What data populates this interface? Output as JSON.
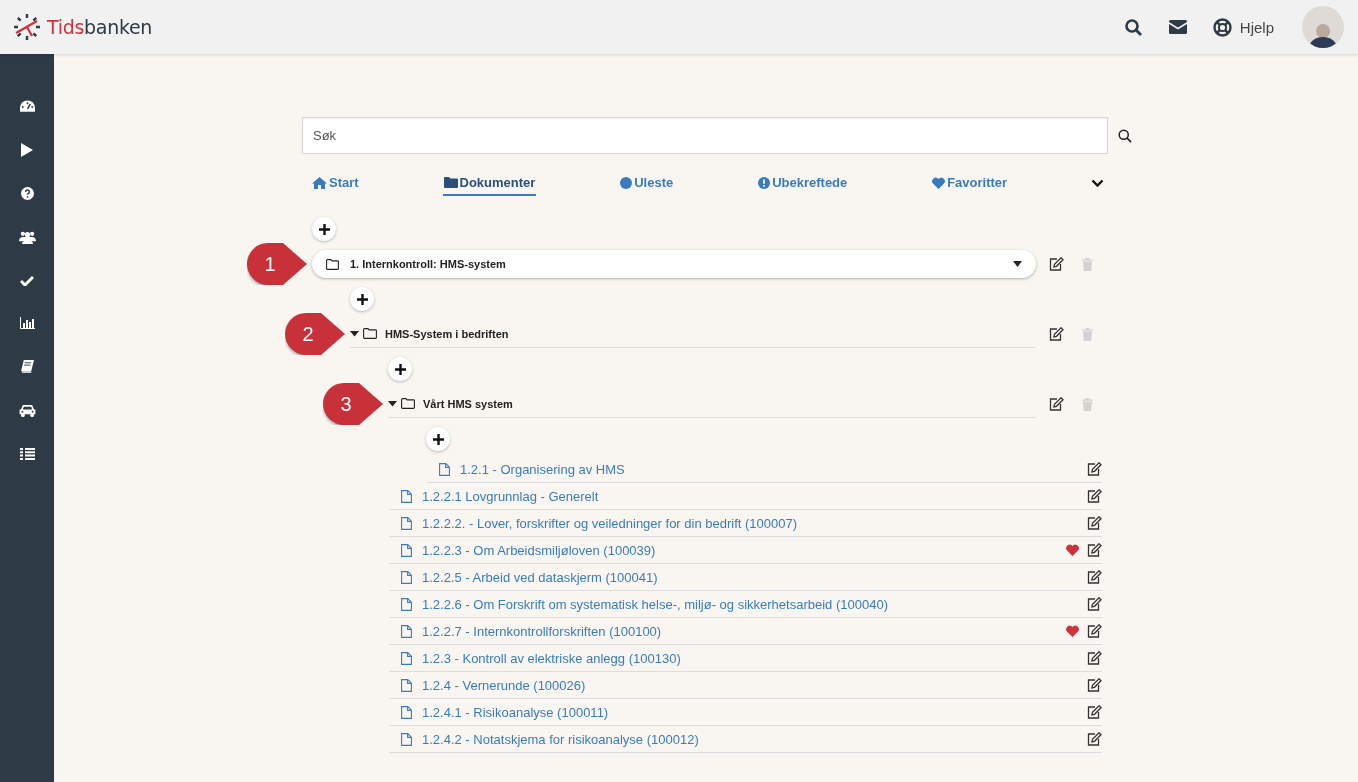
{
  "header": {
    "logo": {
      "accent": "Tids",
      "rest": "banken"
    },
    "help_label": "Hjelp"
  },
  "sidebar": {
    "groups": [
      [
        {
          "kind": "gauge"
        },
        {
          "kind": "play"
        }
      ],
      [
        {
          "kind": "question"
        },
        {
          "kind": "users"
        },
        {
          "kind": "check"
        },
        {
          "kind": "chart"
        },
        {
          "kind": "book"
        },
        {
          "kind": "car"
        },
        {
          "kind": "list"
        }
      ]
    ]
  },
  "search": {
    "placeholder": "Søk"
  },
  "tabs": [
    {
      "label": "Start",
      "kind": "home",
      "selected": false
    },
    {
      "label": "Dokumenter",
      "kind": "folder",
      "selected": true
    },
    {
      "label": "Uleste",
      "kind": "circle",
      "selected": false
    },
    {
      "label": "Ubekreftede",
      "kind": "alert",
      "selected": false
    },
    {
      "label": "Favoritter",
      "kind": "heart",
      "selected": false
    }
  ],
  "tree": [
    {
      "kind": "folder",
      "label": "1. Internkontroll: HMS-system",
      "callout": "1",
      "expanded": true,
      "children": [
        {
          "kind": "folder",
          "label": "HMS-System i bedriften",
          "callout": "2",
          "expanded": true,
          "children": [
            {
              "kind": "folder",
              "label": "Vårt HMS system",
              "callout": "3",
              "expanded": true,
              "children": [
                {
                  "kind": "document",
                  "label": "1.2.1 - Organisering av HMS",
                  "favorite": false
                }
              ]
            },
            {
              "kind": "document",
              "label": "1.2.2.1 Lovgrunnlag - Generelt",
              "favorite": false
            },
            {
              "kind": "document",
              "label": "1.2.2.2. - Lover, forskrifter og veiledninger for din bedrift (100007)",
              "favorite": false
            },
            {
              "kind": "document",
              "label": "1.2.2.3 - Om Arbeidsmiljøloven (100039)",
              "favorite": true
            },
            {
              "kind": "document",
              "label": "1.2.2.5 - Arbeid ved dataskjerm (100041)",
              "favorite": false
            },
            {
              "kind": "document",
              "label": "1.2.2.6 - Om Forskrift om systematisk helse-, miljø- og sikkerhetsarbeid (100040)",
              "favorite": false
            },
            {
              "kind": "document",
              "label": "1.2.2.7 - Internkontrollforskriften (100100)",
              "favorite": true
            },
            {
              "kind": "document",
              "label": "1.2.3 - Kontroll av elektriske anlegg (100130)",
              "favorite": false
            },
            {
              "kind": "document",
              "label": "1.2.4 - Vernerunde (100026)",
              "favorite": false
            },
            {
              "kind": "document",
              "label": "1.2.4.1 - Risikoanalyse (100011)",
              "favorite": false
            },
            {
              "kind": "document",
              "label": "1.2.4.2 - Notatskjema for risikoanalyse (100012)",
              "favorite": false
            }
          ]
        }
      ]
    }
  ]
}
